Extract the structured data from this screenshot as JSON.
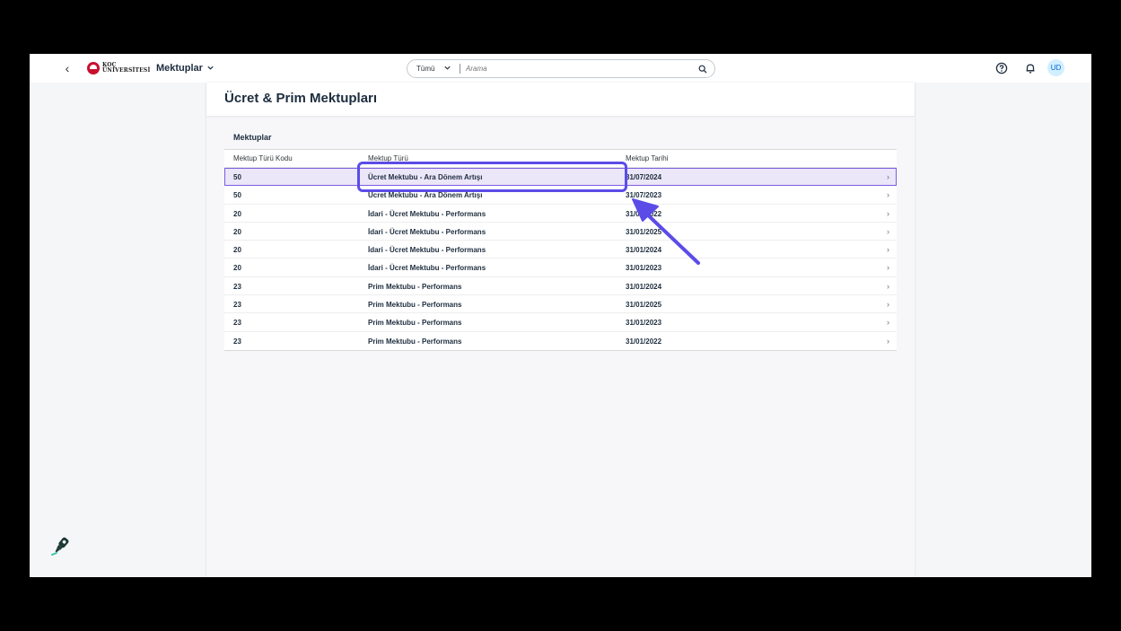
{
  "shell": {
    "logo_line1": "KOÇ",
    "logo_line2": "ÜNİVERSİTESİ",
    "app_title": "Mektuplar",
    "search_scope": "Tümü",
    "search_placeholder": "Arama",
    "avatar_initials": "UD"
  },
  "page": {
    "title": "Ücret & Prim Mektupları"
  },
  "table": {
    "title": "Mektuplar",
    "columns": [
      "Mektup Türü Kodu",
      "Mektup Türü",
      "Mektup Tarihi"
    ],
    "rows": [
      {
        "code": "50",
        "type": "Ücret Mektubu - Ara Dönem Artışı",
        "date": "31/07/2024",
        "selected": true
      },
      {
        "code": "50",
        "type": "Ücret Mektubu - Ara Dönem Artışı",
        "date": "31/07/2023",
        "selected": false
      },
      {
        "code": "20",
        "type": "İdari - Ücret Mektubu - Performans",
        "date": "31/01/2022",
        "selected": false
      },
      {
        "code": "20",
        "type": "İdari - Ücret Mektubu - Performans",
        "date": "31/01/2025",
        "selected": false
      },
      {
        "code": "20",
        "type": "İdari - Ücret Mektubu - Performans",
        "date": "31/01/2024",
        "selected": false
      },
      {
        "code": "20",
        "type": "İdari - Ücret Mektubu - Performans",
        "date": "31/01/2023",
        "selected": false
      },
      {
        "code": "23",
        "type": "Prim Mektubu - Performans",
        "date": "31/01/2024",
        "selected": false
      },
      {
        "code": "23",
        "type": "Prim Mektubu - Performans",
        "date": "31/01/2025",
        "selected": false
      },
      {
        "code": "23",
        "type": "Prim Mektubu - Performans",
        "date": "31/01/2023",
        "selected": false
      },
      {
        "code": "23",
        "type": "Prim Mektubu - Performans",
        "date": "31/01/2022",
        "selected": false
      }
    ]
  },
  "icons": {
    "back": "chevron-left-icon",
    "app_menu": "chevron-down-icon",
    "search": "search-icon",
    "help": "help-icon",
    "notifications": "bell-icon",
    "row_nav": "chevron-right-icon",
    "tool": "brush-icon"
  },
  "colors": {
    "annotation": "#5b4ce8",
    "selected_row": "#ebe6f8",
    "brand_red": "#c8102e",
    "avatar_bg": "#d1efff"
  }
}
